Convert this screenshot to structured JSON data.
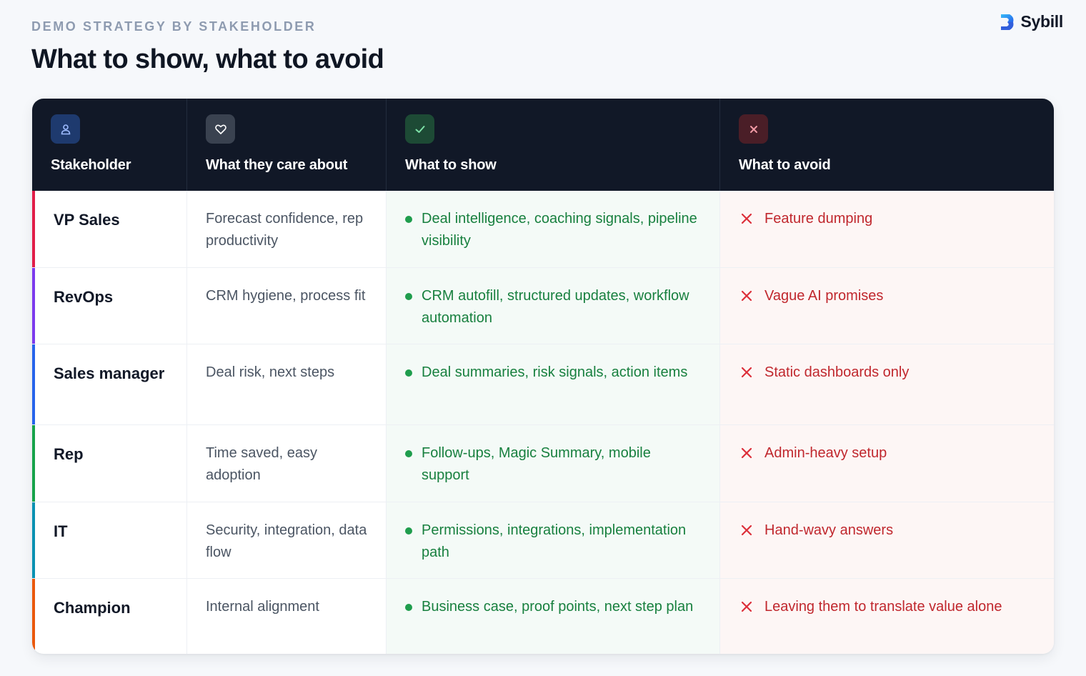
{
  "header": {
    "eyebrow": "DEMO STRATEGY BY STAKEHOLDER",
    "title": "What to show, what to avoid",
    "brand": "Sybill"
  },
  "columns": [
    {
      "label": "Stakeholder",
      "icon": "user-icon",
      "icon_bg": "#1e3a6e",
      "icon_color": "#93b4ff"
    },
    {
      "label": "What they care about",
      "icon": "heart-icon",
      "icon_bg": "#3a4250",
      "icon_color": "#ffffff"
    },
    {
      "label": "What to show",
      "icon": "check-icon",
      "icon_bg": "#1d4a35",
      "icon_color": "#7ee2a8"
    },
    {
      "label": "What to avoid",
      "icon": "x-icon",
      "icon_bg": "#4a1e27",
      "icon_color": "#f19aa4"
    }
  ],
  "rows": [
    {
      "stakeholder": "VP Sales",
      "care": "Forecast confidence, rep productivity",
      "show": "Deal intelligence, coaching signals, pipeline visibility",
      "avoid": "Feature dumping",
      "accent": "#e11d48"
    },
    {
      "stakeholder": "RevOps",
      "care": "CRM hygiene, process fit",
      "show": "CRM autofill, structured updates, workflow automation",
      "avoid": "Vague AI promises",
      "accent": "#7c3aed"
    },
    {
      "stakeholder": "Sales manager",
      "care": "Deal risk, next steps",
      "show": "Deal summaries, risk signals, action items",
      "avoid": "Static dashboards only",
      "accent": "#2563eb"
    },
    {
      "stakeholder": "Rep",
      "care": "Time saved, easy adoption",
      "show": "Follow-ups, Magic Summary, mobile support",
      "avoid": "Admin-heavy setup",
      "accent": "#16a34a"
    },
    {
      "stakeholder": "IT",
      "care": "Security, integration, data flow",
      "show": "Permissions, integrations, implementation path",
      "avoid": "Hand-wavy answers",
      "accent": "#0891b2"
    },
    {
      "stakeholder": "Champion",
      "care": "Internal alignment",
      "show": "Business case, proof points, next step plan",
      "avoid": "Leaving them to translate value alone",
      "accent": "#ea580c"
    }
  ]
}
